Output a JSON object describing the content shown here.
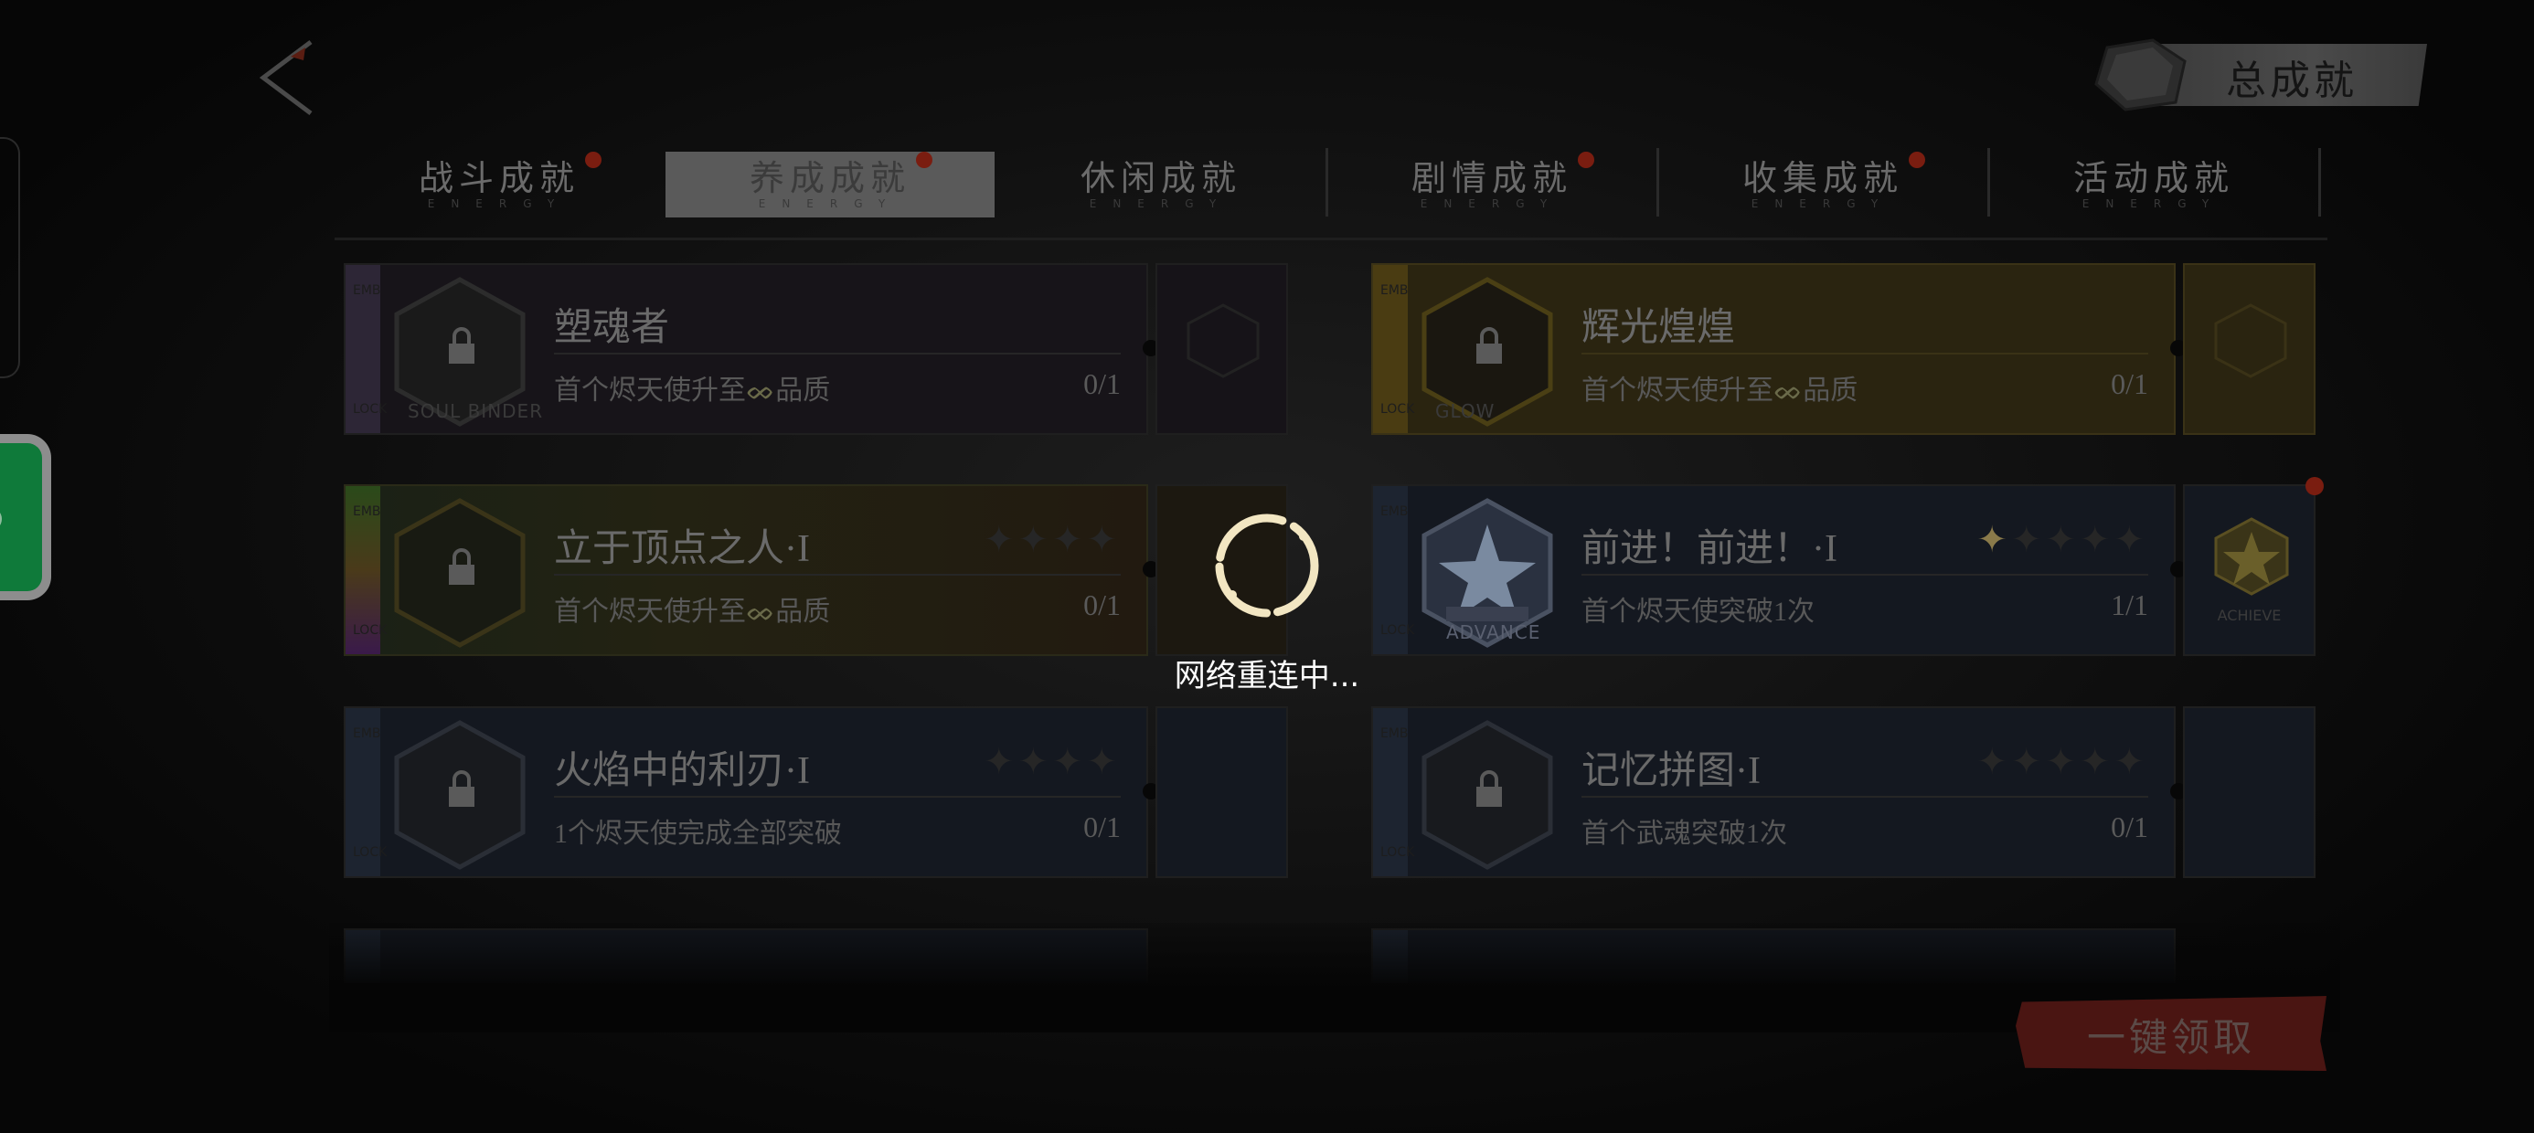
{
  "header": {
    "total_label": "总成就"
  },
  "tabs": [
    {
      "label": "战斗成就",
      "sub": "ENERGY",
      "badge": true,
      "active": false
    },
    {
      "label": "养成成就",
      "sub": "ENERGY",
      "badge": true,
      "active": true
    },
    {
      "label": "休闲成就",
      "sub": "ENERGY",
      "badge": false,
      "active": false
    },
    {
      "label": "剧情成就",
      "sub": "ENERGY",
      "badge": true,
      "active": false
    },
    {
      "label": "收集成就",
      "sub": "ENERGY",
      "badge": true,
      "active": false
    },
    {
      "label": "活动成就",
      "sub": "ENERGY",
      "badge": false,
      "active": false
    }
  ],
  "cards": [
    {
      "title": "塑魂者",
      "desc": "首个烬天使升至",
      "desc_suffix": "品质",
      "progress": "0/1",
      "caption": "SOUL BINDER",
      "stripe": "#3a2f4a",
      "stars": 0,
      "max_stars": 0
    },
    {
      "title": "辉光煌煌",
      "desc": "首个烬天使升至",
      "desc_suffix": "品质",
      "progress": "0/1",
      "caption": "GLOW",
      "stripe": "#6b5a1f",
      "stars": 0,
      "max_stars": 0
    },
    {
      "title": "立于顶点之人·I",
      "desc": "首个烬天使升至",
      "desc_suffix": "品质",
      "progress": "0/1",
      "caption": "",
      "stripe": "#4a6a2f",
      "stars": 0,
      "max_stars": 4
    },
    {
      "title": "前进！前进！·I",
      "desc": "首个烬天使突破1次",
      "desc_suffix": "",
      "progress": "1/1",
      "caption": "ADVANCE",
      "stripe": "#24303f",
      "stars": 1,
      "max_stars": 5
    },
    {
      "title": "火焰中的利刃·I",
      "desc": "1个烬天使完成全部突破",
      "desc_suffix": "",
      "progress": "0/1",
      "caption": "",
      "stripe": "#24303f",
      "stars": 0,
      "max_stars": 4
    },
    {
      "title": "记忆拼图·I",
      "desc": "首个武魂突破1次",
      "desc_suffix": "",
      "progress": "0/1",
      "caption": "",
      "stripe": "#24303f",
      "stars": 0,
      "max_stars": 5
    }
  ],
  "reward_caption": "ACHIEVE",
  "claim_label": "一键领取",
  "loading_text": "网络重连中..."
}
